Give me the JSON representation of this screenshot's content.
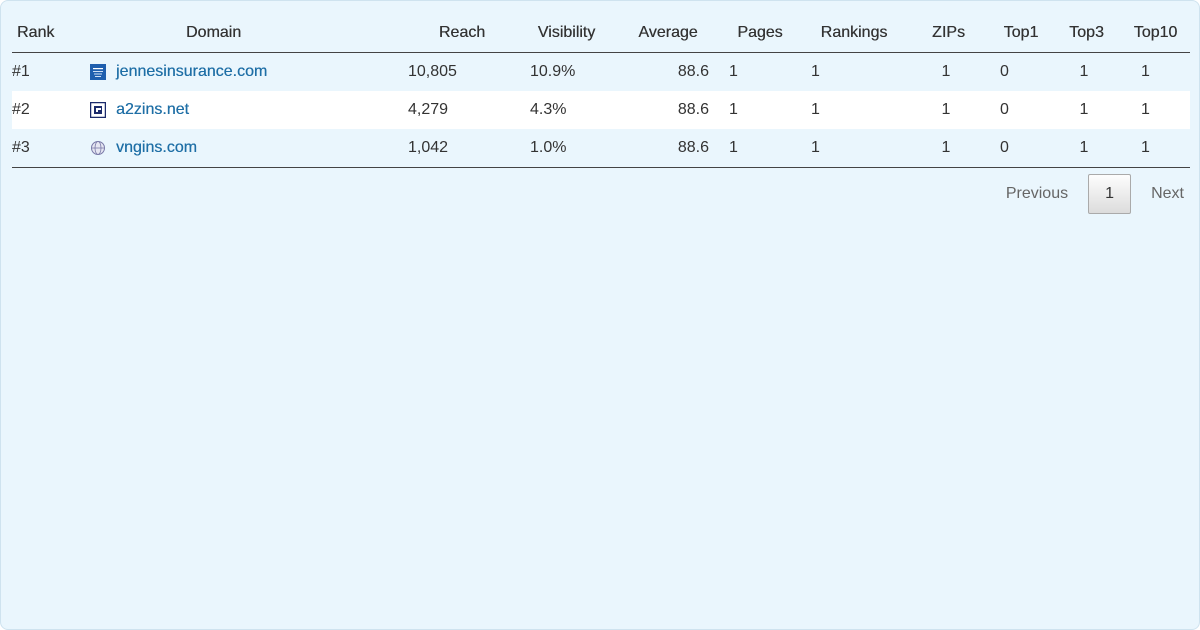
{
  "table": {
    "columns": [
      "Rank",
      "Domain",
      "Reach",
      "Visibility",
      "Average",
      "Pages",
      "Rankings",
      "ZIPs",
      "Top1",
      "Top3",
      "Top10"
    ],
    "rows": [
      {
        "rank": "#1",
        "domain": "jennesinsurance.com",
        "favicon": "jennes-logo-icon",
        "reach": "10,805",
        "visibility": "10.9%",
        "average": "88.6",
        "pages": "1",
        "rankings": "1",
        "zips": "1",
        "top1": "0",
        "top3": "1",
        "top10": "1"
      },
      {
        "rank": "#2",
        "domain": "a2zins.net",
        "favicon": "a2zins-logo-icon",
        "reach": "4,279",
        "visibility": "4.3%",
        "average": "88.6",
        "pages": "1",
        "rankings": "1",
        "zips": "1",
        "top1": "0",
        "top3": "1",
        "top10": "1"
      },
      {
        "rank": "#3",
        "domain": "vngins.com",
        "favicon": "globe-icon",
        "reach": "1,042",
        "visibility": "1.0%",
        "average": "88.6",
        "pages": "1",
        "rankings": "1",
        "zips": "1",
        "top1": "0",
        "top3": "1",
        "top10": "1"
      }
    ]
  },
  "pagination": {
    "previous_label": "Previous",
    "current_page": "1",
    "next_label": "Next"
  },
  "colors": {
    "panel_background": "#eaf6fd",
    "link": "#1f6fa6",
    "text": "#333333"
  }
}
